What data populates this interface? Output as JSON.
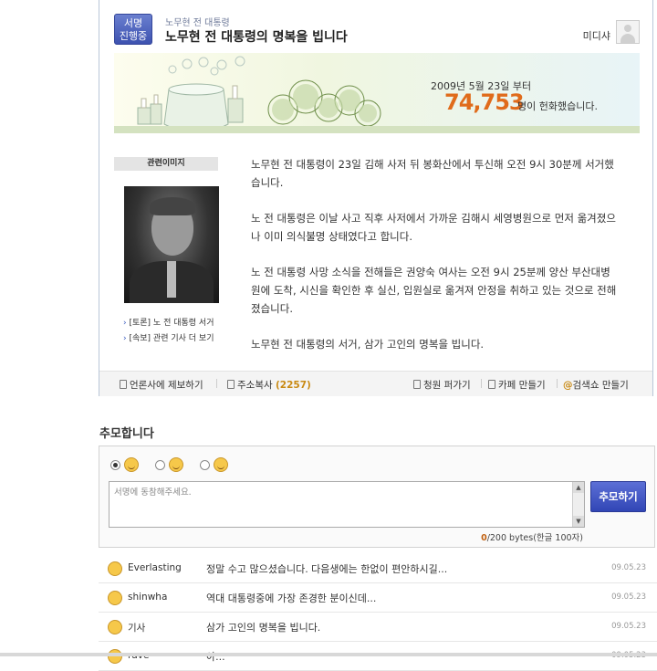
{
  "card": {
    "badge": [
      "서명",
      "진행중"
    ],
    "subtitle": "노무현 전 대통령",
    "title": "노무현 전 대통령의 명복을 빕니다",
    "user": "미디샤"
  },
  "banner": {
    "date": "2009년 5월 23일 부터",
    "count": "74,753",
    "suffix": "명이 헌화했습니다."
  },
  "side": {
    "image_label": "관련이미지",
    "links": [
      "[토론] 노 전 대통령 서거",
      "[속보] 관련 기사 더 보기"
    ]
  },
  "body": [
    "노무현 전 대통령이 23일 김해 사저 뒤 봉화산에서 투신해 오전 9시 30분께 서거했습니다.",
    "노 전 대통령은 이날 사고 직후 사저에서 가까운 김해시 세영병원으로 먼저 옮겨졌으나 이미 의식불명 상태였다고 합니다.",
    "노 전 대통령 사망 소식을 전해들은 권양숙 여사는 오전 9시 25분께 양산 부산대병원에 도착, 시신을 확인한 후 실신, 입원실로 옮겨져 안정을 취하고 있는 것으로 전해졌습니다.",
    "노무현 전 대통령의 서거, 삼가 고인의 명복을 빕니다."
  ],
  "toolbar": {
    "report": "언론사에 제보하기",
    "address": "주소복사",
    "address_count": "(2257)",
    "petition": "청원 퍼가기",
    "cafe": "카페 만들기",
    "search": "검색쇼 만들기"
  },
  "section_title": "추모합니다",
  "comment_form": {
    "placeholder": "서명에 동참해주세요.",
    "submit": "추모하기",
    "bytes_current": "0",
    "bytes_rest": "/200 bytes(한글 100자)"
  },
  "comments": [
    {
      "name": "Everlasting",
      "text": "정말 수고 많으셨습니다. 다음생에는 한없이 편안하시길...",
      "date": "09.05.23"
    },
    {
      "name": "shinwha",
      "text": "역대 대통령중에 가장 존경한 분이신데...",
      "date": "09.05.23"
    },
    {
      "name": "기사",
      "text": "삼가 고인의 명복을 빕니다.",
      "date": "09.05.23"
    },
    {
      "name": "rave",
      "text": "아...",
      "date": "09.05.23"
    }
  ],
  "colors": {
    "accent": "#3d52b0",
    "count": "#e06b1b"
  }
}
